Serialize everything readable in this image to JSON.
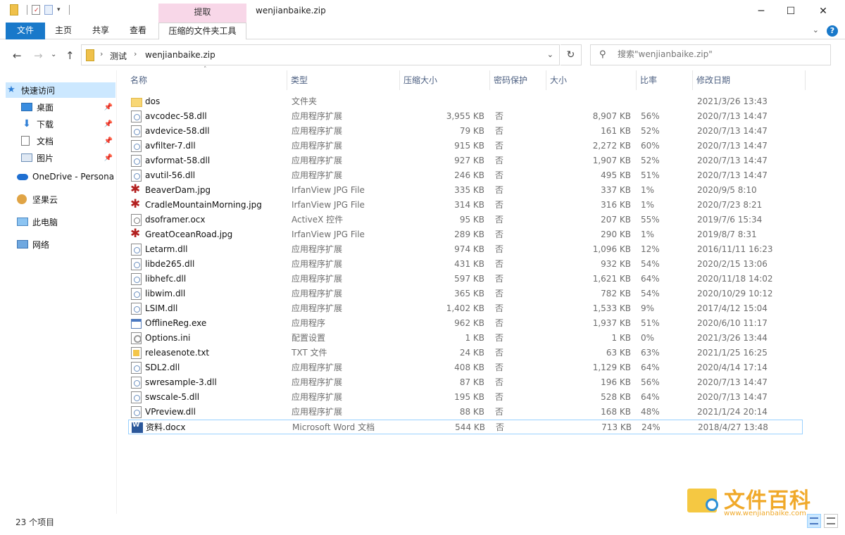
{
  "window": {
    "title": "wenjianbaike.zip",
    "context_tab_header": "提取",
    "controls": {
      "minimize": "─",
      "maximize": "☐",
      "close": "✕"
    }
  },
  "ribbon": {
    "tabs": [
      "文件",
      "主页",
      "共享",
      "查看",
      "压缩的文件夹工具"
    ],
    "collapse_icon": "chevron-down-icon",
    "help_label": "?"
  },
  "address": {
    "breadcrumbs": [
      "测试",
      "wenjianbaike.zip"
    ],
    "search_placeholder": "搜索\"wenjianbaike.zip\""
  },
  "nav": {
    "items": [
      {
        "label": "快速访问",
        "icon": "star-icon",
        "pinned": false
      },
      {
        "label": "桌面",
        "icon": "desktop-icon",
        "pinned": true
      },
      {
        "label": "下载",
        "icon": "download-icon",
        "pinned": true
      },
      {
        "label": "文档",
        "icon": "document-icon",
        "pinned": true
      },
      {
        "label": "图片",
        "icon": "pictures-icon",
        "pinned": true
      },
      {
        "label": "OneDrive - Persona",
        "icon": "cloud-icon",
        "pinned": false
      },
      {
        "label": "坚果云",
        "icon": "nut-icon",
        "pinned": false
      },
      {
        "label": "此电脑",
        "icon": "computer-icon",
        "pinned": false
      },
      {
        "label": "网络",
        "icon": "network-icon",
        "pinned": false
      }
    ]
  },
  "columns": [
    "名称",
    "类型",
    "压缩大小",
    "密码保护",
    "大小",
    "比率",
    "修改日期"
  ],
  "files": [
    {
      "name": "dos",
      "icon": "folder",
      "type": "文件夹",
      "compressed": "",
      "password": "",
      "size": "",
      "ratio": "",
      "modified": "2021/3/26 13:43"
    },
    {
      "name": "avcodec-58.dll",
      "icon": "dll",
      "type": "应用程序扩展",
      "compressed": "3,955 KB",
      "password": "否",
      "size": "8,907 KB",
      "ratio": "56%",
      "modified": "2020/7/13 14:47"
    },
    {
      "name": "avdevice-58.dll",
      "icon": "dll",
      "type": "应用程序扩展",
      "compressed": "79 KB",
      "password": "否",
      "size": "161 KB",
      "ratio": "52%",
      "modified": "2020/7/13 14:47"
    },
    {
      "name": "avfilter-7.dll",
      "icon": "dll",
      "type": "应用程序扩展",
      "compressed": "915 KB",
      "password": "否",
      "size": "2,272 KB",
      "ratio": "60%",
      "modified": "2020/7/13 14:47"
    },
    {
      "name": "avformat-58.dll",
      "icon": "dll",
      "type": "应用程序扩展",
      "compressed": "927 KB",
      "password": "否",
      "size": "1,907 KB",
      "ratio": "52%",
      "modified": "2020/7/13 14:47"
    },
    {
      "name": "avutil-56.dll",
      "icon": "dll",
      "type": "应用程序扩展",
      "compressed": "246 KB",
      "password": "否",
      "size": "495 KB",
      "ratio": "51%",
      "modified": "2020/7/13 14:47"
    },
    {
      "name": "BeaverDam.jpg",
      "icon": "jpg",
      "type": "IrfanView JPG File",
      "compressed": "335 KB",
      "password": "否",
      "size": "337 KB",
      "ratio": "1%",
      "modified": "2020/9/5 8:10"
    },
    {
      "name": "CradleMountainMorning.jpg",
      "icon": "jpg",
      "type": "IrfanView JPG File",
      "compressed": "314 KB",
      "password": "否",
      "size": "316 KB",
      "ratio": "1%",
      "modified": "2020/7/23 8:21"
    },
    {
      "name": "dsoframer.ocx",
      "icon": "ocx",
      "type": "ActiveX 控件",
      "compressed": "95 KB",
      "password": "否",
      "size": "207 KB",
      "ratio": "55%",
      "modified": "2019/7/6 15:34"
    },
    {
      "name": "GreatOceanRoad.jpg",
      "icon": "jpg",
      "type": "IrfanView JPG File",
      "compressed": "289 KB",
      "password": "否",
      "size": "290 KB",
      "ratio": "1%",
      "modified": "2019/8/7 8:31"
    },
    {
      "name": "Letarm.dll",
      "icon": "dll",
      "type": "应用程序扩展",
      "compressed": "974 KB",
      "password": "否",
      "size": "1,096 KB",
      "ratio": "12%",
      "modified": "2016/11/11 16:23"
    },
    {
      "name": "libde265.dll",
      "icon": "dll",
      "type": "应用程序扩展",
      "compressed": "431 KB",
      "password": "否",
      "size": "932 KB",
      "ratio": "54%",
      "modified": "2020/2/15 13:06"
    },
    {
      "name": "libhefc.dll",
      "icon": "dll",
      "type": "应用程序扩展",
      "compressed": "597 KB",
      "password": "否",
      "size": "1,621 KB",
      "ratio": "64%",
      "modified": "2020/11/18 14:02"
    },
    {
      "name": "libwim.dll",
      "icon": "dll",
      "type": "应用程序扩展",
      "compressed": "365 KB",
      "password": "否",
      "size": "782 KB",
      "ratio": "54%",
      "modified": "2020/10/29 10:12"
    },
    {
      "name": "LSIM.dll",
      "icon": "dll",
      "type": "应用程序扩展",
      "compressed": "1,402 KB",
      "password": "否",
      "size": "1,533 KB",
      "ratio": "9%",
      "modified": "2017/4/12 15:04"
    },
    {
      "name": "OfflineReg.exe",
      "icon": "exe",
      "type": "应用程序",
      "compressed": "962 KB",
      "password": "否",
      "size": "1,937 KB",
      "ratio": "51%",
      "modified": "2020/6/10 11:17"
    },
    {
      "name": "Options.ini",
      "icon": "ini",
      "type": "配置设置",
      "compressed": "1 KB",
      "password": "否",
      "size": "1 KB",
      "ratio": "0%",
      "modified": "2021/3/26 13:44"
    },
    {
      "name": "releasenote.txt",
      "icon": "txt",
      "type": "TXT 文件",
      "compressed": "24 KB",
      "password": "否",
      "size": "63 KB",
      "ratio": "63%",
      "modified": "2021/1/25 16:25"
    },
    {
      "name": "SDL2.dll",
      "icon": "dll",
      "type": "应用程序扩展",
      "compressed": "408 KB",
      "password": "否",
      "size": "1,129 KB",
      "ratio": "64%",
      "modified": "2020/4/14 17:14"
    },
    {
      "name": "swresample-3.dll",
      "icon": "dll",
      "type": "应用程序扩展",
      "compressed": "87 KB",
      "password": "否",
      "size": "196 KB",
      "ratio": "56%",
      "modified": "2020/7/13 14:47"
    },
    {
      "name": "swscale-5.dll",
      "icon": "dll",
      "type": "应用程序扩展",
      "compressed": "195 KB",
      "password": "否",
      "size": "528 KB",
      "ratio": "64%",
      "modified": "2020/7/13 14:47"
    },
    {
      "name": "VPreview.dll",
      "icon": "dll",
      "type": "应用程序扩展",
      "compressed": "88 KB",
      "password": "否",
      "size": "168 KB",
      "ratio": "48%",
      "modified": "2021/1/24 20:14"
    },
    {
      "name": "资料.docx",
      "icon": "docx",
      "type": "Microsoft Word 文档",
      "compressed": "544 KB",
      "password": "否",
      "size": "713 KB",
      "ratio": "24%",
      "modified": "2018/4/27 13:48"
    }
  ],
  "status": {
    "item_count": "23 个项目"
  },
  "watermark": {
    "brand": "文件百科",
    "site": "www.wenjianbaike.com"
  }
}
